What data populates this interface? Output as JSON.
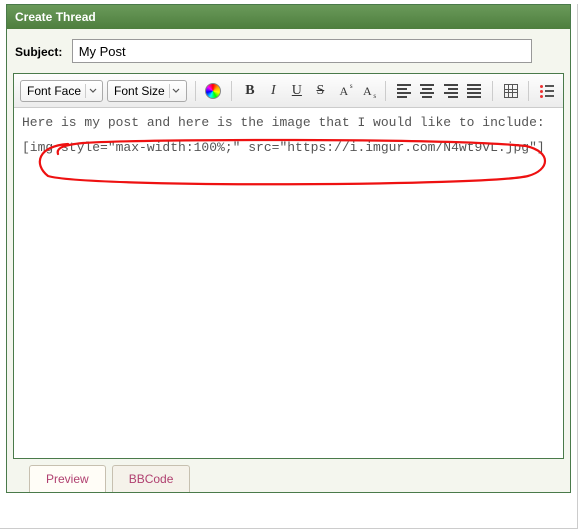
{
  "panel": {
    "title": "Create Thread"
  },
  "subject": {
    "label": "Subject:",
    "value": "My Post"
  },
  "toolbar": {
    "font_face": "Font Face",
    "font_size": "Font Size"
  },
  "editor": {
    "line1": "Here is my post and here is the image that I would like to include:",
    "line2": "[img style=\"max-width:100%;\" src=\"https://i.imgur.com/N4wt9vL.jpg\"]"
  },
  "tabs": {
    "preview": "Preview",
    "bbcode": "BBCode"
  }
}
